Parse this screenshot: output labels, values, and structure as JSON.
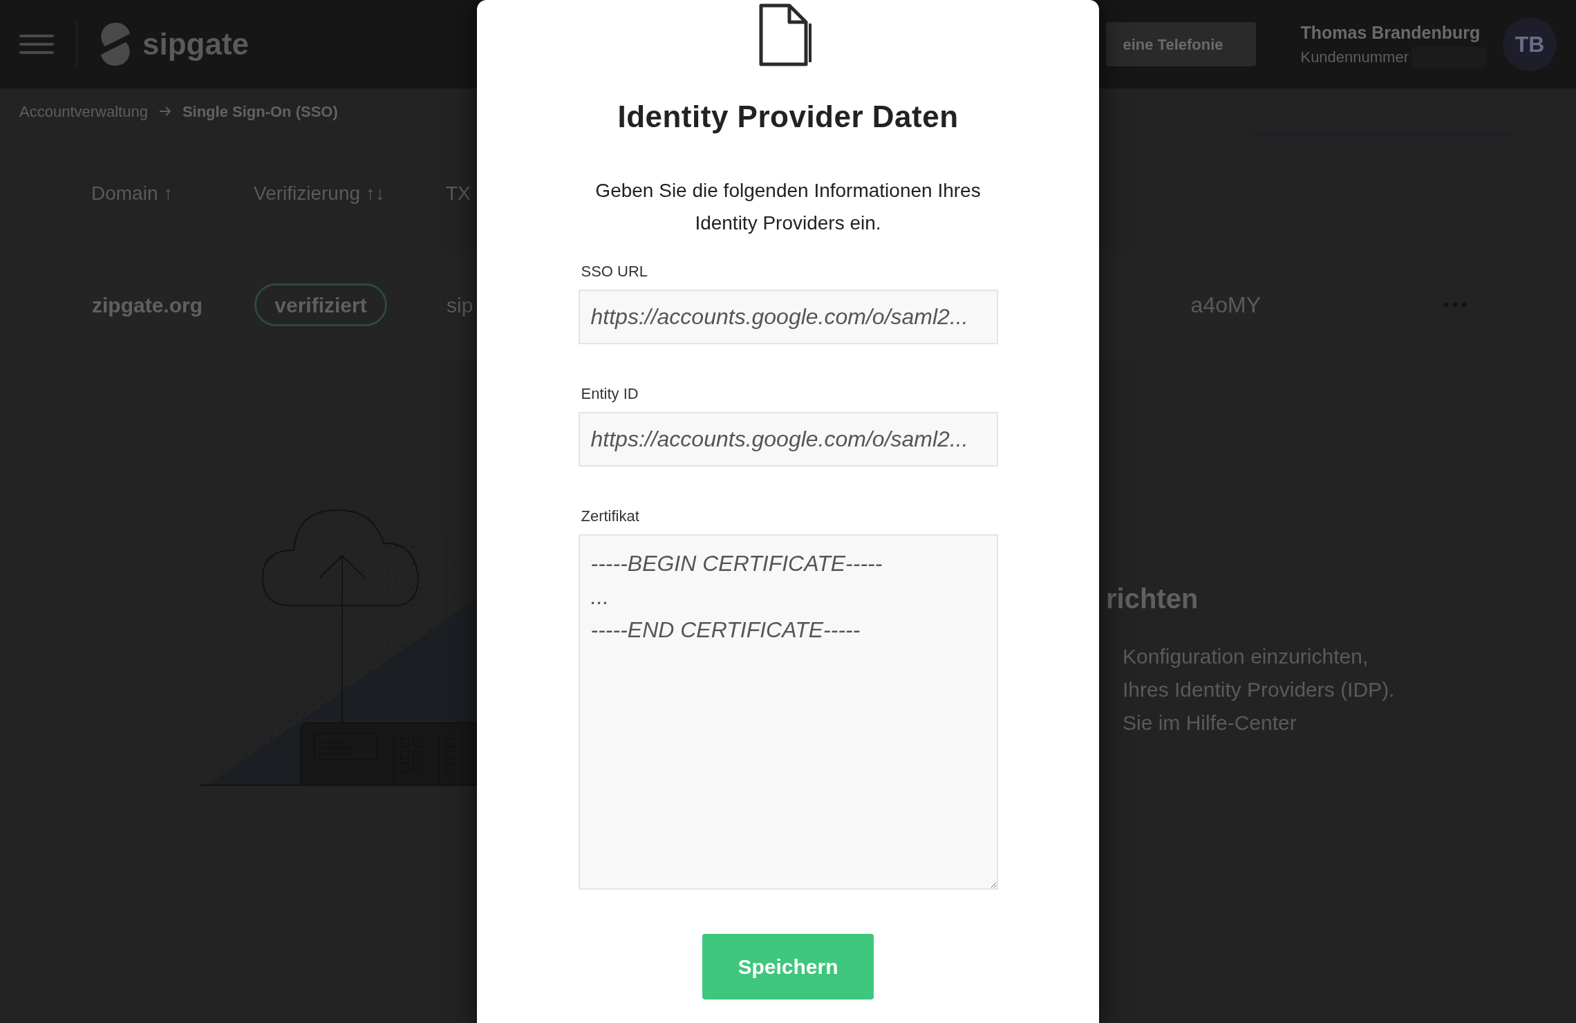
{
  "header": {
    "logo": "sipgate",
    "nav_button": "eine Telefonie",
    "user": {
      "name": "Thomas Brandenburg",
      "customer_label": "Kundennummer",
      "initials": "TB"
    }
  },
  "breadcrumb": [
    "Accountverwaltung",
    "Single Sign-On (SSO)"
  ],
  "table": {
    "columns": [
      {
        "label": "Domain",
        "sort": "↑"
      },
      {
        "label": "Verifizierung",
        "sort": "↑↓"
      },
      {
        "label": "TX"
      }
    ],
    "rows": [
      {
        "domain": "zipgate.org",
        "status": "verifiziert",
        "column_3": "sip",
        "column_4": "a4oMY"
      }
    ]
  },
  "info": {
    "heading": "richten",
    "lines": [
      "Konfiguration einzurichten,",
      "Ihres Identity Providers (IDP).",
      "Sie im Hilfe-Center"
    ]
  },
  "modal": {
    "title": "Identity Provider Daten",
    "description": "Geben Sie die folgenden Informationen Ihres Identity Providers ein.",
    "fields": [
      {
        "kind": "input",
        "label": "SSO URL",
        "placeholder": "https://accounts.google.com/o/saml2..."
      },
      {
        "kind": "input",
        "label": "Entity ID",
        "placeholder": "https://accounts.google.com/o/saml2..."
      },
      {
        "kind": "textarea",
        "label": "Zertifikat",
        "placeholder": "-----BEGIN CERTIFICATE-----\n...\n-----END CERTIFICATE-----"
      }
    ],
    "submit": "Speichern"
  }
}
